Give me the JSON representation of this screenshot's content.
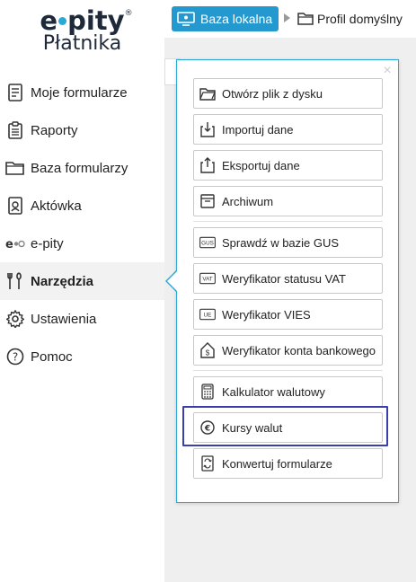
{
  "logo": {
    "brand_left": "e",
    "brand_right": "pity",
    "reg": "®",
    "sub": "Płatnika"
  },
  "nav": {
    "items": [
      {
        "label": "Moje formularze",
        "icon": "form-list-icon"
      },
      {
        "label": "Raporty",
        "icon": "clipboard-icon"
      },
      {
        "label": "Baza formularzy",
        "icon": "folder-icon"
      },
      {
        "label": "Aktówka",
        "icon": "briefcase-icon"
      },
      {
        "label": "e-pity",
        "icon": "epity-logo-icon"
      },
      {
        "label": "Narzędzia",
        "icon": "tools-icon",
        "active": true
      },
      {
        "label": "Ustawienia",
        "icon": "gear-icon"
      },
      {
        "label": "Pomoc",
        "icon": "help-icon"
      }
    ]
  },
  "breadcrumb": {
    "database": "Baza lokalna",
    "profile": "Profil domyślny"
  },
  "popup": {
    "close": "×",
    "group1": [
      {
        "label": "Otwórz plik z dysku",
        "icon": "folder-open-icon"
      },
      {
        "label": "Importuj dane",
        "icon": "import-icon"
      },
      {
        "label": "Eksportuj dane",
        "icon": "export-icon"
      },
      {
        "label": "Archiwum",
        "icon": "archive-icon"
      }
    ],
    "group2": [
      {
        "label": "Sprawdź w bazie GUS",
        "icon": "gus-icon",
        "badge": "GUS"
      },
      {
        "label": "Weryfikator statusu VAT",
        "icon": "vat-icon",
        "badge": "VAT"
      },
      {
        "label": "Weryfikator VIES",
        "icon": "vies-icon",
        "badge": "UE"
      },
      {
        "label": "Weryfikator konta bankowego",
        "icon": "bank-icon"
      }
    ],
    "group3": [
      {
        "label": "Kalkulator walutowy",
        "icon": "calculator-icon"
      },
      {
        "label": "Kursy walut",
        "icon": "euro-icon",
        "highlighted": true
      },
      {
        "label": "Konwertuj formularze",
        "icon": "convert-icon"
      }
    ]
  },
  "colors": {
    "accent": "#2399cf",
    "highlight": "#3b3fae",
    "brand_dark": "#1e2a3a"
  }
}
